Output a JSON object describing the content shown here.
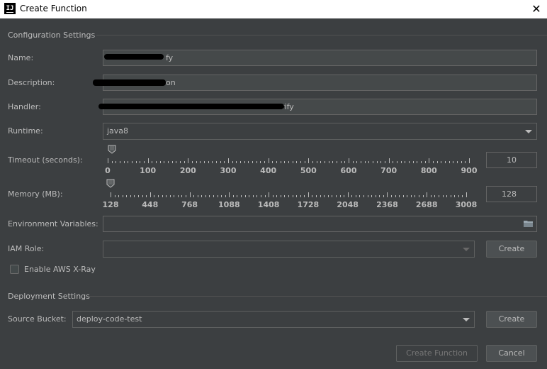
{
  "window": {
    "title": "Create Function",
    "app_icon": "intellij-icon",
    "close_icon": "close-icon"
  },
  "config_section": {
    "title": "Configuration Settings"
  },
  "fields": {
    "name_label": "Name:",
    "description_label": "Description:",
    "handler_label": "Handler:",
    "name_value": "fy",
    "description_value": "on",
    "handler_value": "rify",
    "runtime_label": "Runtime:",
    "runtime_value": "java8",
    "timeout_label": "Timeout (seconds):",
    "memory_label": "Memory (MB):",
    "env_label": "Environment Variables:",
    "env_value": "",
    "env_icon": "folder-icon",
    "iam_label": "IAM Role:",
    "iam_value": "",
    "iam_create": "Create",
    "xray_label": "Enable AWS X-Ray",
    "xray_checked": false
  },
  "timeout_slider": {
    "value": 10,
    "display": "10",
    "min": 0,
    "max": 900,
    "tick_labels": [
      "0",
      "100",
      "200",
      "300",
      "400",
      "500",
      "600",
      "700",
      "800",
      "900"
    ]
  },
  "memory_slider": {
    "value": 128,
    "display": "128",
    "min": 128,
    "max": 3008,
    "tick_labels": [
      "128",
      "448",
      "768",
      "1088",
      "1408",
      "1728",
      "2048",
      "2368",
      "2688",
      "3008"
    ]
  },
  "deploy_section": {
    "title": "Deployment Settings"
  },
  "deploy": {
    "bucket_label": "Source Bucket:",
    "bucket_value": "deploy-code-test",
    "bucket_create": "Create"
  },
  "footer": {
    "create_function": "Create Function",
    "cancel": "Cancel"
  },
  "colors": {
    "background": "#3c3f41",
    "field": "#45494a",
    "border": "#646464",
    "text": "#bbbbbb",
    "title_bar": "#ffffff"
  }
}
